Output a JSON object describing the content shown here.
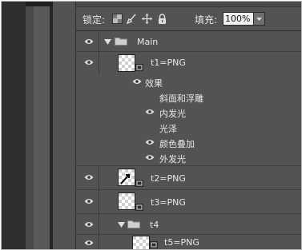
{
  "lock_bar": {
    "lock_label": "锁定:",
    "fill_label": "填充:",
    "fill_value": "100%"
  },
  "layers": {
    "main_group": "Main",
    "t1": "t1=PNG",
    "effects_label": "效果",
    "effects": [
      "斜面和浮雕",
      "内发光",
      "光泽",
      "颜色叠加",
      "外发光"
    ],
    "t2": "t2=PNG",
    "t3": "t3=PNG",
    "t4_group": "t4",
    "t5": "t5=PNG"
  },
  "colors": {
    "panel_bg": "#535353",
    "selected_row": "#535353",
    "fill_input_bg": "#f0f0f0"
  }
}
